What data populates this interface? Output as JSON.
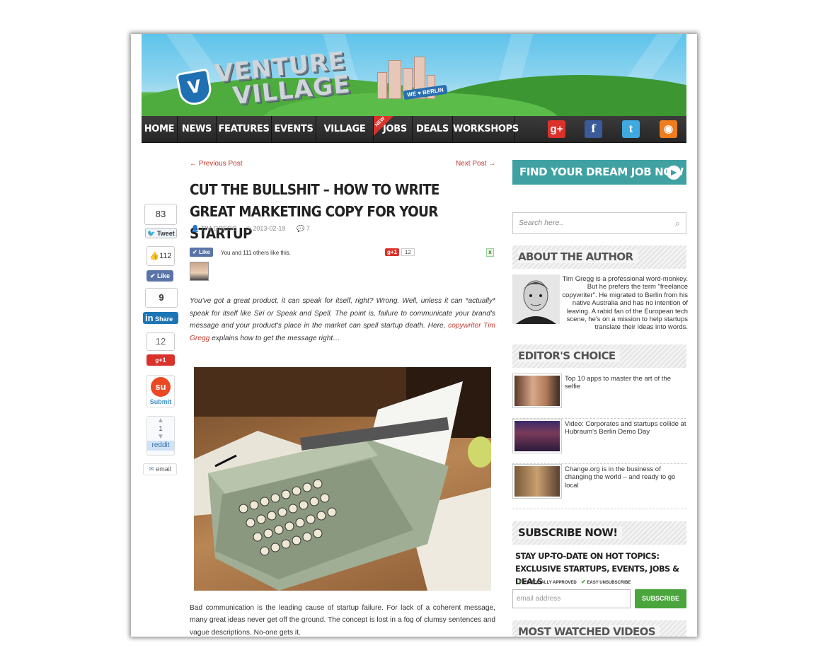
{
  "header": {
    "logo_line1": "VENTURE",
    "logo_line2": "VILLAGE",
    "logo_letter": "V",
    "berlin_badge": "WE ♥ BERLIN"
  },
  "nav": {
    "items": [
      "HOME",
      "NEWS",
      "FEATURES",
      "EVENTS",
      "VILLAGE TV",
      "JOBS",
      "DEALS",
      "WORKSHOPS"
    ],
    "new_tag": "NEW",
    "social": [
      {
        "icon": "google-plus-icon",
        "glyph": "g+",
        "color": "#d9322a"
      },
      {
        "icon": "facebook-icon",
        "glyph": "f",
        "color": "#3b5a9a"
      },
      {
        "icon": "twitter-icon",
        "glyph": "t",
        "color": "#3fa9e0"
      },
      {
        "icon": "rss-icon",
        "glyph": "◉",
        "color": "#ef7c1e"
      }
    ]
  },
  "share": {
    "tweet_count": "83",
    "tweet_label": "Tweet",
    "like_count": "112",
    "like_label": "Like",
    "linkedin_count": "9",
    "linkedin_label": "Share",
    "linkedin_in": "in",
    "gplus_count": "12",
    "gplus_label": "+1",
    "stumble_label": "Submit",
    "reddit_count": "1",
    "reddit_label": "reddit",
    "email_label": "email"
  },
  "article": {
    "prev_post": "← Previous Post",
    "next_post": "Next Post →",
    "title": "CUT THE BULLSHIT – HOW TO WRITE GREAT MARKETING COPY FOR YOUR STARTUP",
    "author": "TIM GREGG",
    "date": "2013-02-19",
    "comments": "7",
    "fb_like_button": "Like",
    "fb_like_text": "You and 111 others like this.",
    "gplus_button": "+1",
    "gplus_count": "12",
    "intro_before_link": "You've got a great product, it can speak for itself, right? Wrong. Well, unless it can *actually* speak for itself like Siri or Speak and Spell. The point is, failure to communicate your brand's message and your product's place in the market can spell startup death. Here,",
    "intro_link": "copywriter Tim Gregg",
    "intro_after_link": "explains how to get the message right…",
    "body": "Bad communication is the leading cause of startup failure. For lack of a coherent message, many great ideas never get off the ground. The concept is lost in a fog of clumsy sentences and vague descriptions. No-one gets it."
  },
  "sidebar": {
    "jobs_banner": "FIND YOUR DREAM JOB NOW",
    "search_placeholder": "Search here..",
    "about_title": "ABOUT THE AUTHOR",
    "about_text": "Tim Gregg is a professional word-monkey. But he prefers the term \"freelance copywriter\". He migrated to Berlin from his native Australia and has no intention of leaving. A rabid fan of the European tech scene, he's on a mission to help startups translate their ideas into words.",
    "editors_title": "EDITOR'S CHOICE",
    "editors_items": [
      "Top 10 apps to master the art of the selfie",
      "Video: Corporates and startups collide at Hubraum's Berlin Demo Day",
      "Change.org is in the business of changing the world – and ready to go local"
    ],
    "subscribe_title": "SUBSCRIBE NOW!",
    "subscribe_line1": "STAY UP-TO-DATE ON HOT TOPICS:",
    "subscribe_line2": "EXCLUSIVE STARTUPS, EVENTS, JOBS & DEALS",
    "subscribe_check1": "EDITORIALLY APPROVED",
    "subscribe_check2": "EASY UNSUBSCRIBE",
    "email_placeholder": "email address",
    "subscribe_button": "SUBSCRIBE",
    "most_watched_title": "MOST WATCHED VIDEOS"
  }
}
